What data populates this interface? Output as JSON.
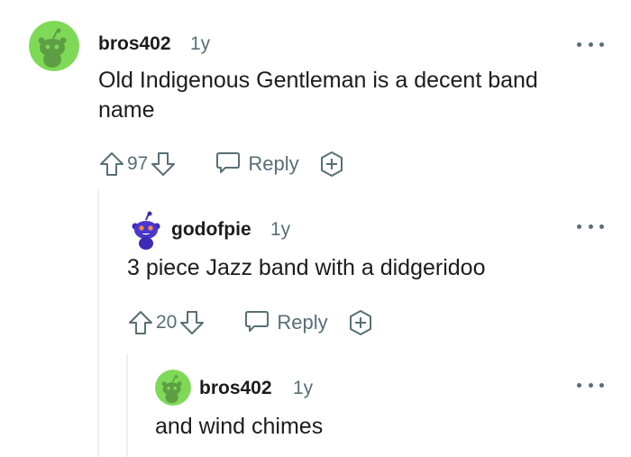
{
  "comments": [
    {
      "username": "bros402",
      "age": "1y",
      "text": "Old Indigenous Gentleman is a decent band name",
      "score": "97",
      "reply_label": "Reply",
      "avatar_icon": "snoo-avatar-icon",
      "avatar_color": "#7ed957"
    },
    {
      "username": "godofpie",
      "age": "1y",
      "text": "3 piece Jazz band with a didgeridoo",
      "score": "20",
      "reply_label": "Reply",
      "avatar_icon": "snoo-avatar-icon",
      "avatar_color": "#3d2bb5"
    },
    {
      "username": "bros402",
      "age": "1y",
      "text": "and wind chimes",
      "avatar_icon": "snoo-avatar-icon",
      "avatar_color": "#7ed957"
    }
  ],
  "colors": {
    "text": "#1c1c1c",
    "meta": "#576f76",
    "thread_line": "#edeff1"
  }
}
